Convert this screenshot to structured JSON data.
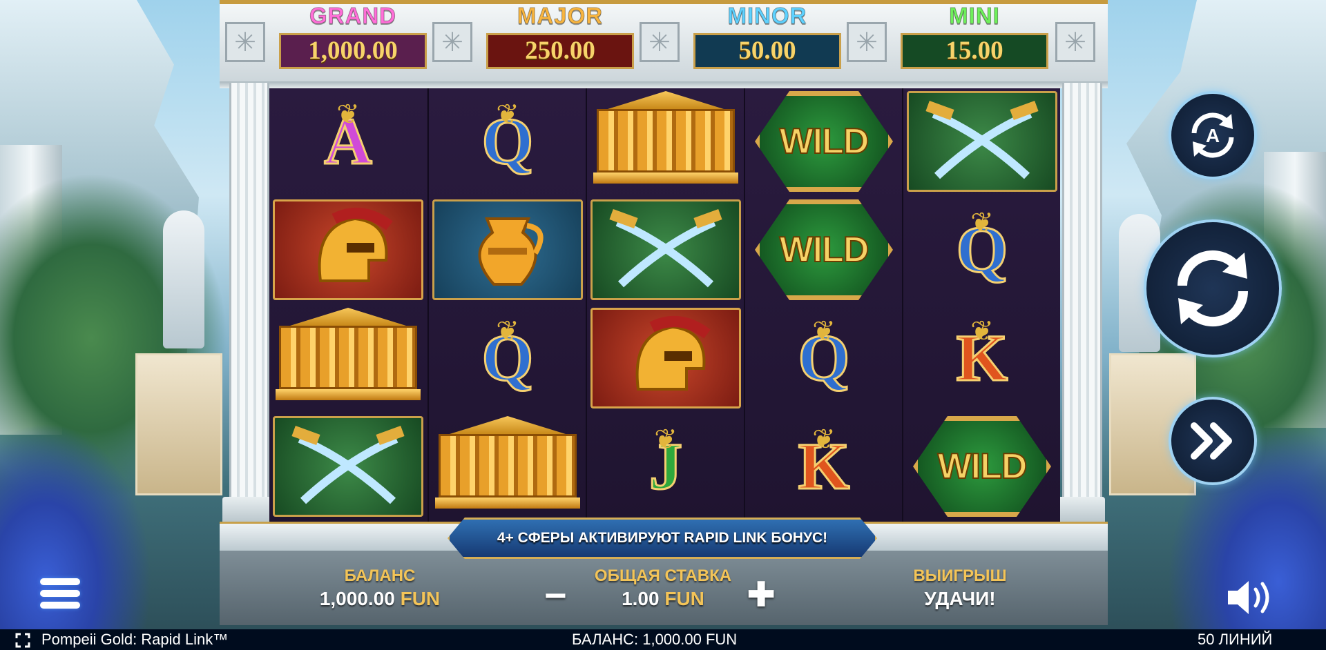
{
  "jackpots": [
    {
      "label": "GRAND",
      "value": "1,000.00",
      "label_color": "#ff6fd8",
      "box_color": "#5a1f4e"
    },
    {
      "label": "MAJOR",
      "value": "250.00",
      "label_color": "#f8b540",
      "box_color": "#6a1410"
    },
    {
      "label": "MINOR",
      "value": "50.00",
      "label_color": "#5fd2ff",
      "box_color": "#113a52"
    },
    {
      "label": "MINI",
      "value": "15.00",
      "label_color": "#6ef05a",
      "box_color": "#154a24"
    }
  ],
  "reels": [
    [
      "A",
      "helmet",
      "temple",
      "swords"
    ],
    [
      "Q",
      "vase",
      "Q",
      "temple"
    ],
    [
      "temple",
      "swords",
      "helmet",
      "J"
    ],
    [
      "WILD",
      "WILD",
      "Q",
      "K"
    ],
    [
      "swords",
      "Q",
      "K",
      "WILD"
    ]
  ],
  "wild_text": "WILD",
  "banner": "4+ СФЕРЫ АКТИВИРУЮТ RAPID LINK БОНУС!",
  "balance": {
    "label": "БАЛАНС",
    "amount": "1,000.00",
    "currency": "FUN"
  },
  "bet": {
    "label": "ОБЩАЯ СТАВКА",
    "amount": "1.00",
    "currency": "FUN",
    "minus": "−",
    "plus": "✚"
  },
  "win": {
    "label": "ВЫИГРЫШ",
    "value": "УДАЧИ!"
  },
  "buttons": {
    "autoplay_icon": "autoplay-icon",
    "spin_icon": "spin-icon",
    "turbo_icon": "fast-forward-icon",
    "menu_icon": "hamburger-menu-icon",
    "sound_icon": "speaker-icon",
    "fullscreen_icon": "fullscreen-icon"
  },
  "status_bar": {
    "game_title": "Pompeii Gold: Rapid Link™",
    "balance_text": "БАЛАНС: 1,000.00 FUN",
    "lines_text": "50 ЛИНИЙ"
  },
  "colors": {
    "gold": "#f3c458",
    "accent_blue": "#9fd2f2",
    "reel_bg": "#221633"
  }
}
